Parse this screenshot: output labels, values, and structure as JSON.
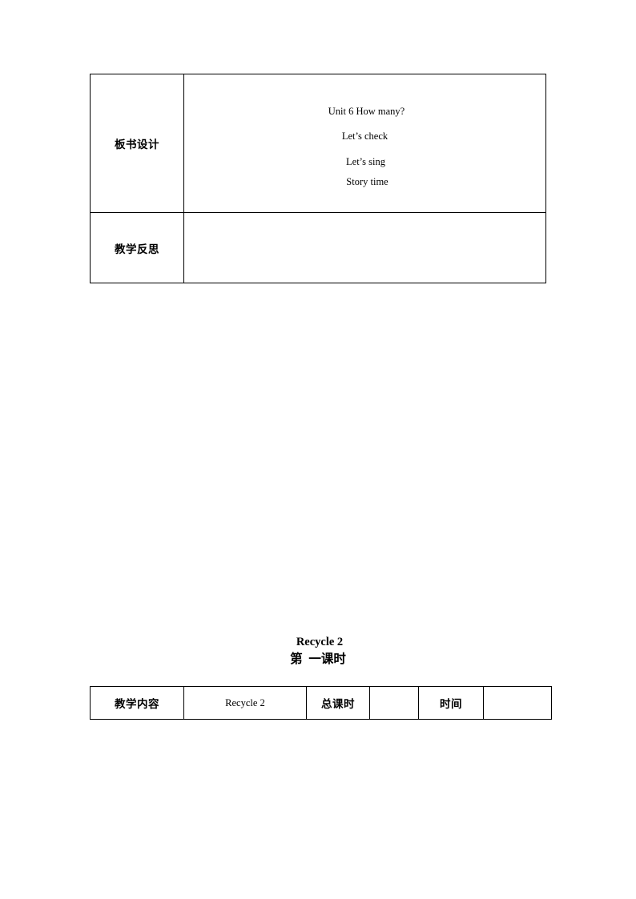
{
  "document": {
    "page_background": "#ffffff",
    "text_color": "#000000",
    "border_color": "#000000"
  },
  "lesson_notes_table": {
    "rows": [
      {
        "label": "板书设计",
        "board_lines": [
          "Unit 6 How many?",
          "Let’s check",
          "Let’s sing",
          "Story time"
        ]
      },
      {
        "label": "教学反思",
        "content": ""
      }
    ]
  },
  "heading": {
    "title": "Recycle 2",
    "subtitle": "第  一课时"
  },
  "lesson_header_table": {
    "cells": [
      {
        "label": "教学内容",
        "type": "label"
      },
      {
        "label": "Recycle 2",
        "type": "value"
      },
      {
        "label": "总课时",
        "type": "label"
      },
      {
        "label": "",
        "type": "blank"
      },
      {
        "label": "时间",
        "type": "label"
      },
      {
        "label": "",
        "type": "blank"
      }
    ]
  }
}
